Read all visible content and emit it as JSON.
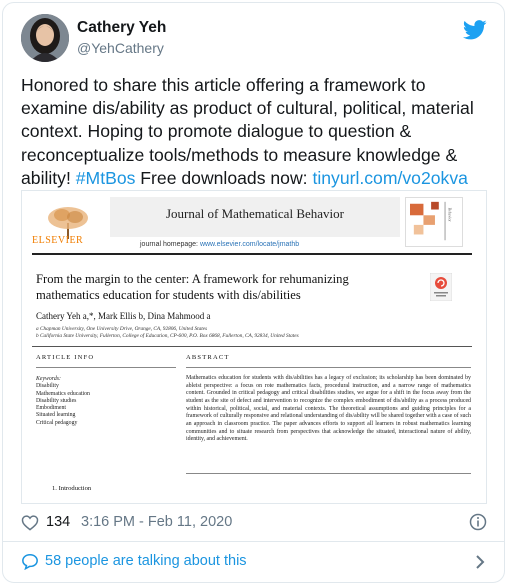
{
  "tweet": {
    "display_name": "Cathery Yeh",
    "handle": "@YehCathery",
    "text_main": "Honored to share this article offering a framework to examine dis/ability as product of cultural, political, material context. Hoping to promote dialogue to question & reconceptualize tools/methods to measure knowledge & ability! ",
    "hashtag": "#MtBos",
    "text_after_hashtag": " Free downloads now: ",
    "url": "tinyurl.com/vo2okva",
    "likes": "134",
    "timestamp": "3:16 PM - Feb 11, 2020",
    "talking": "58 people are talking about this"
  },
  "article": {
    "publisher": "ELSEVIER",
    "journal": "Journal of Mathematical Behavior",
    "homepage_label": "journal homepage: ",
    "homepage_url": "www.elsevier.com/locate/jmathb",
    "title": "From the margin to the center: A framework for rehumanizing mathematics education for students with dis/abilities",
    "authors": "Cathery Yeh a,*, Mark Ellis b, Dina Mahmood a",
    "affiliation_a": "a Chapman University, One University Drive, Orange, CA, 92806, United States",
    "affiliation_b": "b California State University, Fullerton, College of Education, CP-600, P.O. Box 6868, Fullerton, CA, 92834, United States",
    "article_info_head": "ARTICLE INFO",
    "abstract_head": "ABSTRACT",
    "keywords_head": "Keywords:",
    "keywords": [
      "Disability",
      "Mathematics education",
      "Disability studies",
      "Embodiment",
      "Situated learning",
      "Critical pedagogy"
    ],
    "abstract": "Mathematics education for students with dis/abilities has a legacy of exclusion; its scholarship has been dominated by ableist perspective: a focus on rote mathematics facts, procedural instruction, and a narrow range of mathematics content. Grounded in critical pedagogy and critical disabilities studies, we argue for a shift in the focus away from the student as the site of defect and intervention to recognize the complex embodiment of dis/ability as a process produced within historical, political, social, and material contexts. The theoretical assumptions and guiding principles for a framework of culturally responsive and relational understanding of dis/ability will be shared together with a case of such an approach in classroom practice. The paper advances efforts to support all learners in robust mathematics learning communities and to situate research from perspectives that acknowledge the situated, interactional nature of ability, identity, and achievement.",
    "intro": "1.  Introduction"
  },
  "colors": {
    "link": "#1b95e0",
    "muted": "#657786",
    "twitter_blue": "#1da1f2",
    "elsevier_orange": "#f07d00"
  },
  "icons": [
    "twitter-bird-icon",
    "heart-icon",
    "info-icon",
    "speech-bubble-icon",
    "chevron-right-icon",
    "check-for-updates-icon",
    "elsevier-tree-logo"
  ]
}
